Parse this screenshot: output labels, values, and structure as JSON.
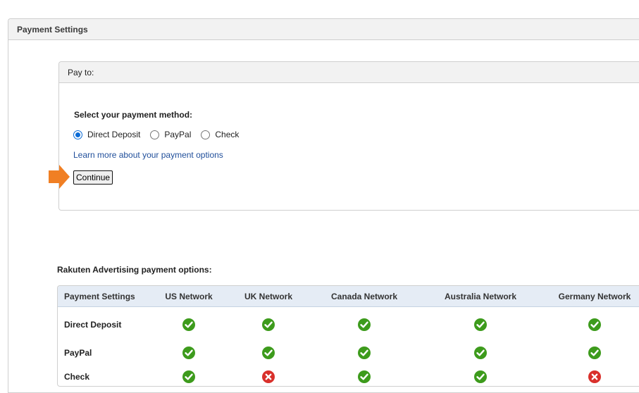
{
  "outer_panel": {
    "title": "Payment Settings"
  },
  "pay_to": {
    "title": "Pay to:",
    "method_label": "Select your payment method:",
    "options": [
      {
        "label": "Direct Deposit",
        "checked": true
      },
      {
        "label": "PayPal",
        "checked": false
      },
      {
        "label": "Check",
        "checked": false
      }
    ],
    "learn_more": "Learn more about your payment options",
    "continue_label": "Continue"
  },
  "options_table": {
    "title": "Rakuten Advertising payment options:",
    "columns": [
      "Payment Settings",
      "US Network",
      "UK Network",
      "Canada Network",
      "Australia Network",
      "Germany Network"
    ],
    "rows": [
      {
        "label": "Direct Deposit",
        "values": [
          "check-icon",
          "check-icon",
          "check-icon",
          "check-icon",
          "check-icon"
        ]
      },
      {
        "label": "PayPal",
        "values": [
          "check-icon",
          "check-icon",
          "check-icon",
          "check-icon",
          "check-icon"
        ]
      },
      {
        "label": "Check",
        "values": [
          "check-icon",
          "cross-icon",
          "check-icon",
          "check-icon",
          "cross-icon"
        ]
      }
    ]
  },
  "colors": {
    "check": "#3d9b1c",
    "cross": "#d9302b",
    "link": "#1f4e9a",
    "radio": "#0b6bd6",
    "arrow": "#f07f24"
  }
}
